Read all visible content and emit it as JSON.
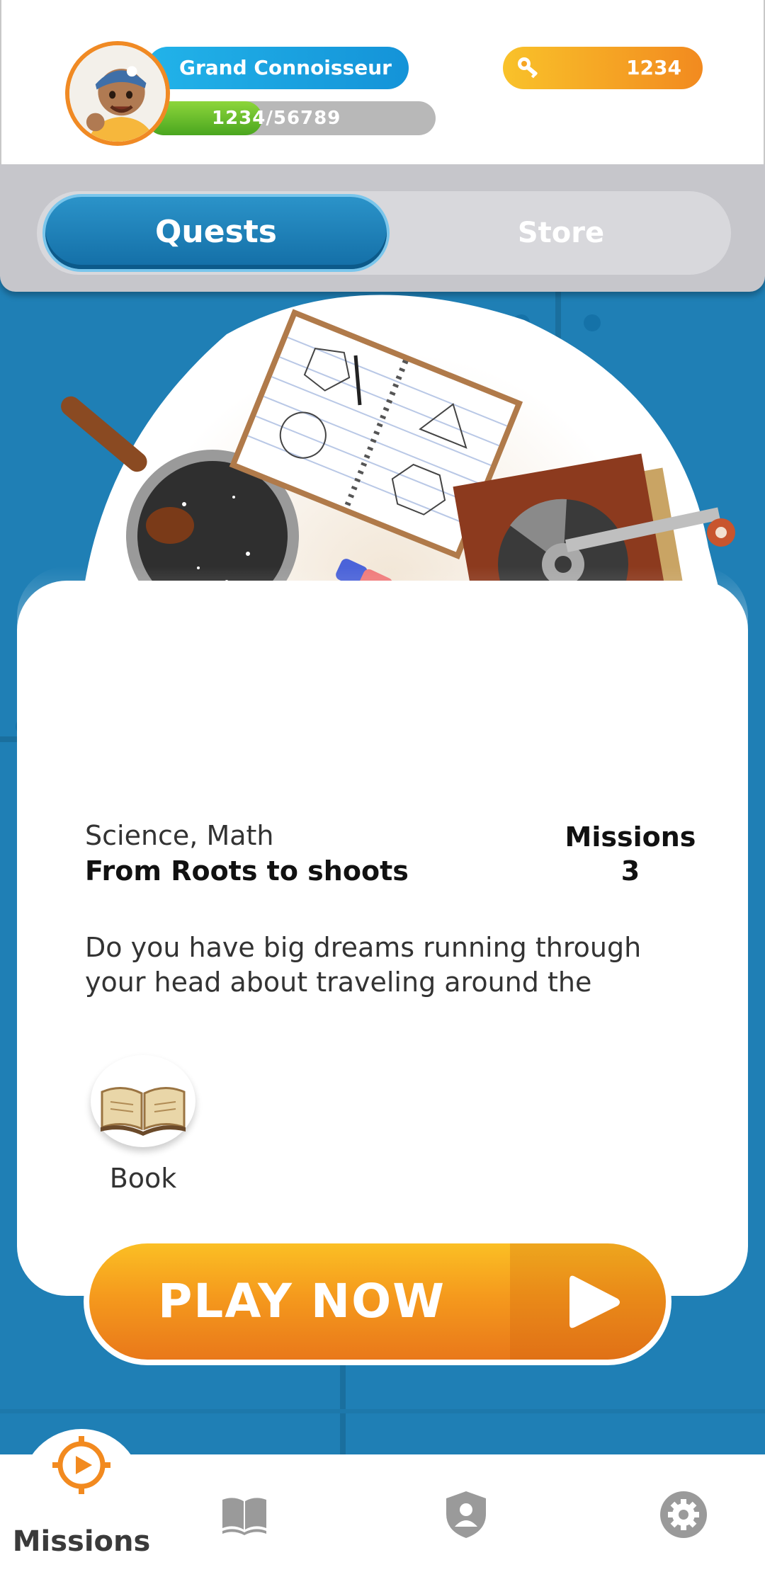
{
  "header": {
    "rank_title": "Grand Connoisseur",
    "xp_text": "1234/56789",
    "xp_progress": 0.4,
    "keys_count": "1234"
  },
  "tabs": {
    "active": "Quests",
    "inactive": "Store"
  },
  "quest": {
    "subject": "Science, Math",
    "title": "From Roots to shoots",
    "missions_label": "Missions",
    "missions_count": "3",
    "description": "Do you have big dreams running through your head about traveling around the",
    "resource_label": "Book"
  },
  "play_button": {
    "label": "PLAY NOW"
  },
  "nav": {
    "items": [
      {
        "label": "Missions",
        "icon": "compass-icon",
        "active": true
      },
      {
        "label": "",
        "icon": "book-icon",
        "active": false
      },
      {
        "label": "",
        "icon": "profile-shield-icon",
        "active": false
      },
      {
        "label": "",
        "icon": "gear-icon",
        "active": false
      }
    ]
  },
  "colors": {
    "accent_blue": "#1a7fb8",
    "accent_orange": "#f28a1f",
    "xp_green": "#5bb526"
  }
}
